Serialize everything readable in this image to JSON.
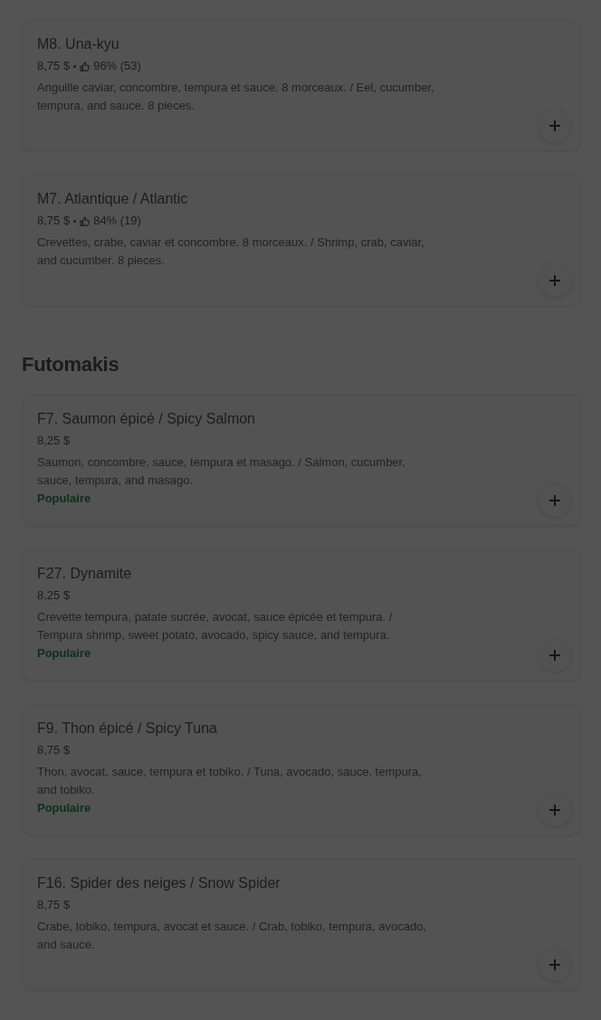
{
  "sections": [
    {
      "items": [
        {
          "title": "M8. Una-kyu",
          "price": "8,75 $",
          "rating": "96% (53)",
          "description": "Anguille caviar, concombre, tempura et sauce. 8 morceaux. / Eel, cucumber, tempura, and sauce. 8 pieces."
        },
        {
          "title": "M7. Atlantique / Atlantic",
          "price": "8,75 $",
          "rating": "84% (19)",
          "description": "Crevettes, crabe, caviar et concombre. 8 morceaux. / Shrimp, crab, caviar, and cucumber. 8 pieces."
        }
      ]
    },
    {
      "heading": "Futomakis",
      "items": [
        {
          "title": "F7. Saumon épicé / Spicy Salmon",
          "price": "8,25 $",
          "description": "Saumon, concombre, sauce, tempura et masago. / Salmon, cucumber, sauce, tempura, and masago.",
          "badge": "Populaire"
        },
        {
          "title": "F27. Dynamite",
          "price": "8,25 $",
          "description": "Crevette tempura, patate sucrée, avocat, sauce épicée et tempura. / Tempura shrimp, sweet potato, avocado, spicy sauce, and tempura.",
          "badge": "Populaire"
        },
        {
          "title": "F9. Thon épicé / Spicy Tuna",
          "price": "8,75 $",
          "description": "Thon, avocat, sauce, tempura et tobiko. / Tuna, avocado, sauce, tempura, and tobiko.",
          "badge": "Populaire"
        },
        {
          "title": "F16. Spider des neiges / Snow Spider",
          "price": "8,75 $",
          "description": "Crabe, tobiko, tempura, avocat et sauce. / Crab, tobiko, tempura, avocado, and sauce."
        }
      ]
    }
  ]
}
